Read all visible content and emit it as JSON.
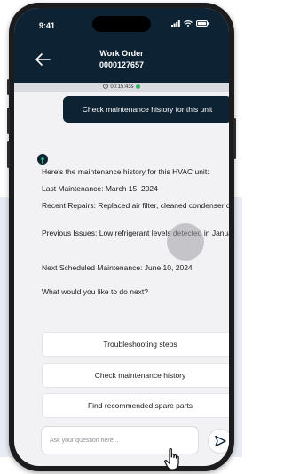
{
  "status": {
    "time": "9:41"
  },
  "header": {
    "title": "Work Order",
    "order_number": "0000127657",
    "timer": "00:15:43s"
  },
  "conversation": {
    "user_message": "Check maintenance history for this unit",
    "assistant_lines": [
      "Here's the maintenance history for this HVAC unit:",
      "Last Maintenance: March 15, 2024",
      "Recent Repairs: Replaced air filter, cleaned condenser coils",
      "Previous Issues: Low refrigerant levels detected in January",
      "Next Scheduled Maintenance: June 10, 2024",
      "What would you like to do next?"
    ],
    "options": [
      "Troubleshooting steps",
      "Check maintenance history",
      "Find recommended spare parts"
    ]
  },
  "composer": {
    "placeholder": "Ask your question here..."
  },
  "colors": {
    "header_bg": "#0d2233",
    "accent_green": "#2fb463",
    "chat_bg": "#f2f2f4"
  },
  "icons": [
    "back-arrow-icon",
    "signal-icon",
    "wifi-icon",
    "battery-icon",
    "bot-icon",
    "send-icon",
    "hand-cursor-icon"
  ]
}
